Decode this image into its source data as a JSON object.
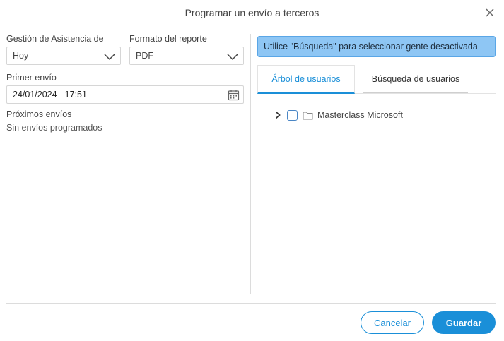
{
  "dialog": {
    "title": "Programar un envío a terceros",
    "close_icon": "close-icon"
  },
  "form": {
    "report_label": "Gestión de Asistencia de",
    "report_value": "Hoy",
    "format_label": "Formato del reporte",
    "format_value": "PDF",
    "first_send_label": "Primer envío",
    "first_send_value": "24/01/2024 - 17:51",
    "next_sends_label": "Próximos envíos",
    "next_sends_value": "Sin envíos programados"
  },
  "right_panel": {
    "info_message": "Utilice \"Búsqueda\" para seleccionar gente desactivada",
    "tabs": [
      {
        "label": "Árbol de usuarios",
        "active": true
      },
      {
        "label": "Búsqueda de usuarios",
        "active": false
      }
    ],
    "tree": [
      {
        "label": "Masterclass Microsoft",
        "checked": false,
        "expanded": false
      }
    ]
  },
  "footer": {
    "cancel_label": "Cancelar",
    "save_label": "Guardar"
  },
  "colors": {
    "accent": "#1a8fd8",
    "info_bg": "#8ec6f4",
    "info_border": "#5aa6e6"
  }
}
